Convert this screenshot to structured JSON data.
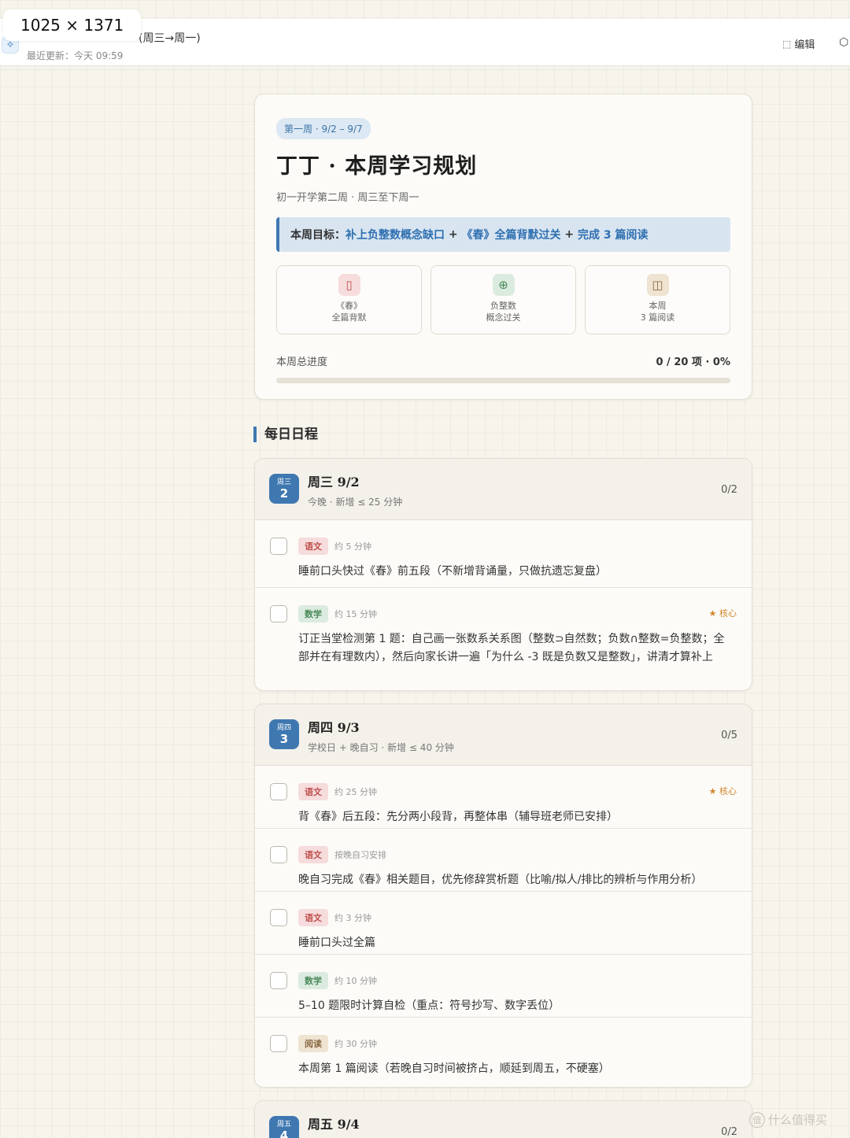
{
  "overlay": {
    "dimensions": "1025 × 1371"
  },
  "header": {
    "app_icon": "app-logo-icon",
    "title_partial": "(周三→周一)",
    "updated": "最近更新：今天 09:59",
    "edit_label": "编辑",
    "edit_icon": "edit-icon",
    "share_icon": "cube-icon"
  },
  "hero": {
    "week_pill": "第一周 · 9/2 – 9/7",
    "title": "丁丁 · 本周学习规划",
    "subtitle": "初一开学第二周 · 周三至下周一",
    "goal_prefix": "本周目标：",
    "goal_1": "补上负整数概念缺口",
    "goal_sep_1": " + ",
    "goal_2": "《春》全篇背默过关",
    "goal_sep_2": " + ",
    "goal_3": "完成 3 篇阅读",
    "metrics": [
      {
        "icon": "book-icon",
        "line1": "《春》",
        "line2": "全篇背默",
        "color": "red"
      },
      {
        "icon": "target-icon",
        "line1": "负整数",
        "line2": "概念过关",
        "color": "green"
      },
      {
        "icon": "open-book-icon",
        "line1": "本周",
        "line2": "3 篇阅读",
        "color": "tan"
      }
    ],
    "progress_label": "本周总进度",
    "progress_value": "0 / 20 项 · 0%",
    "progress_fraction": 0
  },
  "section_title": "每日日程",
  "days": [
    {
      "badge_week": "周三",
      "badge_num": "2",
      "title": "周三 9/2",
      "subtitle": "今晚 · 新增 ≤ 25 分钟",
      "count": "0/2",
      "tasks": [
        {
          "tag": "语文",
          "tag_type": "chinese",
          "time": "约 5 分钟",
          "core": "",
          "text": "睡前口头快过《春》前五段（不新增背诵量，只做抗遗忘复盘）"
        },
        {
          "tag": "数学",
          "tag_type": "math",
          "time": "约 15 分钟",
          "core": "★ 核心",
          "text": "订正当堂检测第 1 题：自己画一张数系关系图（整数⊃自然数；负数∩整数=负整数；全部并在有理数内），然后向家长讲一遍「为什么 -3 既是负数又是整数」，讲清才算补上"
        }
      ]
    },
    {
      "badge_week": "周四",
      "badge_num": "3",
      "title": "周四 9/3",
      "subtitle": "学校日 + 晚自习 · 新增 ≤ 40 分钟",
      "count": "0/5",
      "tasks": [
        {
          "tag": "语文",
          "tag_type": "chinese",
          "time": "约 25 分钟",
          "core": "★ 核心",
          "text": "背《春》后五段：先分两小段背，再整体串（辅导班老师已安排）"
        },
        {
          "tag": "语文",
          "tag_type": "chinese",
          "time": "按晚自习安排",
          "core": "",
          "text": "晚自习完成《春》相关题目，优先修辞赏析题（比喻/拟人/排比的辨析与作用分析）"
        },
        {
          "tag": "语文",
          "tag_type": "chinese",
          "time": "约 3 分钟",
          "core": "",
          "text": "睡前口头过全篇"
        },
        {
          "tag": "数学",
          "tag_type": "math",
          "time": "约 10 分钟",
          "core": "",
          "text": "5–10 题限时计算自检（重点：符号抄写、数字丢位）"
        },
        {
          "tag": "阅读",
          "tag_type": "reading",
          "time": "约 30 分钟",
          "core": "",
          "text": "本周第 1 篇阅读（若晚自习时间被挤占，顺延到周五，不硬塞）"
        }
      ]
    },
    {
      "badge_week": "周五",
      "badge_num": "4",
      "title": "周五 9/4",
      "subtitle": "",
      "count": "0/2",
      "tasks": []
    }
  ],
  "watermark": "什么值得买"
}
